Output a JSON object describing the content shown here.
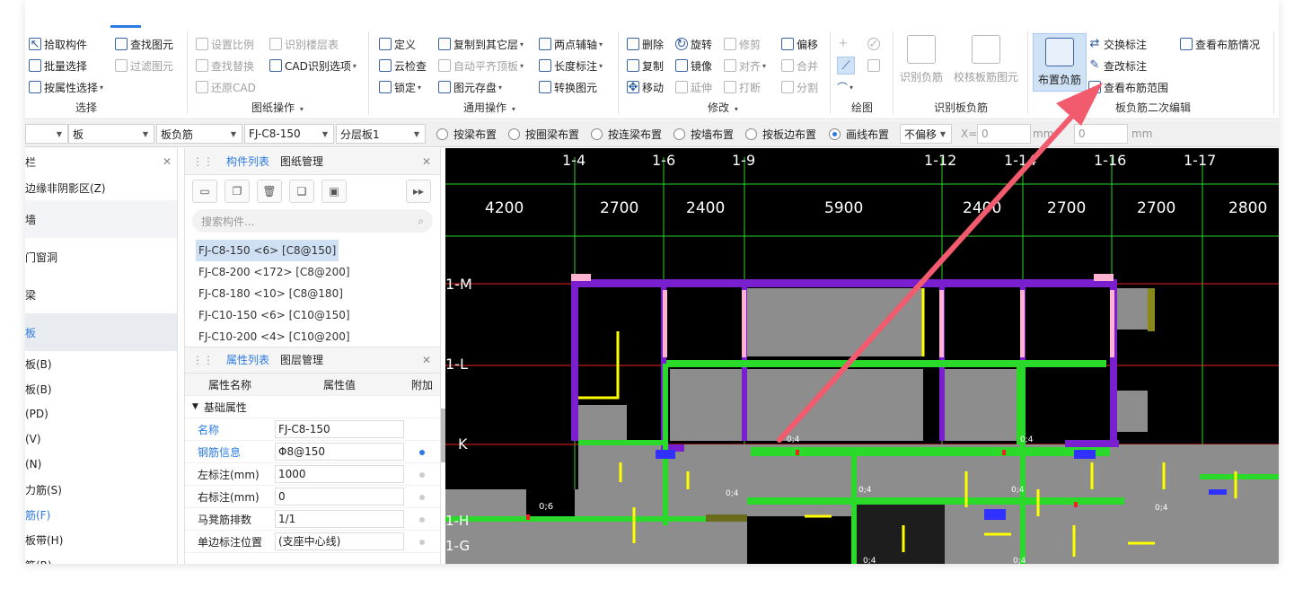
{
  "ribbon": {
    "g1": {
      "title": "选择",
      "items": [
        "拾取构件",
        "批量选择",
        "按属性选择",
        "查找图元",
        "过滤图元"
      ]
    },
    "g2": {
      "title": "图纸操作",
      "items": [
        "设置比例",
        "查找替换",
        "还原CAD",
        "识别楼层表",
        "CAD识别选项"
      ]
    },
    "g3": {
      "title": "通用操作",
      "items": [
        "定义",
        "云检查",
        "锁定",
        "复制到其它层",
        "自动平齐顶板",
        "图元存盘",
        "两点辅轴",
        "长度标注",
        "转换图元"
      ]
    },
    "g4": {
      "title": "修改",
      "items": [
        "删除",
        "复制",
        "移动",
        "旋转",
        "镜像",
        "延伸",
        "修剪",
        "对齐",
        "打断",
        "偏移",
        "合并",
        "分割"
      ]
    },
    "g5": {
      "title": "绘图"
    },
    "g6": {
      "title": "识别板负筋",
      "items": [
        "识别负筋",
        "校核板筋图元"
      ]
    },
    "g7": {
      "title": "板负筋二次编辑",
      "big": "布置负筋",
      "items": [
        "交换标注",
        "查改标注",
        "查看布筋范围",
        "查看布筋情况"
      ]
    }
  },
  "toolbar": {
    "c1": "",
    "c2": "板",
    "c3": "板负筋",
    "c4": "FJ-C8-150",
    "c5": "分层板1",
    "radios": [
      "按梁布置",
      "按圈梁布置",
      "按连梁布置",
      "按墙布置",
      "按板边布置",
      "画线布置"
    ],
    "offset": "不偏移",
    "xlabel": "X=",
    "xval": "0",
    "mm1": "mm",
    "yval": "0",
    "mm2": "mm"
  },
  "leftpanel": {
    "title": "栏",
    "rows": [
      "边缘非阴影区(Z)",
      "墙",
      "门窗洞",
      "梁",
      "板"
    ],
    "subs": [
      "板(B)",
      "板(B)",
      "(PD)",
      "(V)",
      "(N)",
      "力筋(S)",
      "筋(F)",
      "板带(H)",
      "筋(R)"
    ]
  },
  "complist": {
    "tab1": "构件列表",
    "tab2": "图纸管理",
    "search": "搜索构件...",
    "items": [
      "FJ-C8-150 <6> [C8@150]",
      "FJ-C8-200 <172> [C8@200]",
      "FJ-C8-180 <10> [C8@180]",
      "FJ-C10-150 <6> [C10@150]",
      "FJ-C10-200 <4> [C10@200]"
    ]
  },
  "props": {
    "tab1": "属性列表",
    "tab2": "图层管理",
    "h1": "属性名称",
    "h2": "属性值",
    "h3": "附加",
    "section": "基础属性",
    "rows": [
      {
        "name": "名称",
        "value": "FJ-C8-150"
      },
      {
        "name": "钢筋信息",
        "value": "Φ8@150"
      },
      {
        "name": "左标注(mm)",
        "value": "1000"
      },
      {
        "name": "右标注(mm)",
        "value": "0"
      },
      {
        "name": "马凳筋排数",
        "value": "1/1"
      },
      {
        "name": "单边标注位置",
        "value": "(支座中心线)"
      }
    ]
  },
  "canvas": {
    "axes": [
      "1-4",
      "1-6",
      "1-9",
      "1-12",
      "1-14",
      "1-16",
      "1-17"
    ],
    "dims": [
      "4200",
      "2700",
      "2400",
      "5900",
      "2400",
      "2700",
      "2700",
      "2800"
    ],
    "rows": [
      "1-M",
      "1-L",
      "K",
      "1-H",
      "1-G"
    ],
    "marks": [
      "0;4",
      "0;4",
      "0;4",
      "0;4",
      "0;4",
      "0;4",
      "0;6",
      "0;4",
      "0;4"
    ]
  },
  "colors": {
    "accent": "#2c7be5",
    "arrow": "#f25a6e",
    "bg": "#000000",
    "wall": "#9a9a9a",
    "beam_green": "#2bd92b",
    "beam_purple": "#7a1fd0",
    "rebar_yellow": "#ffff00"
  }
}
